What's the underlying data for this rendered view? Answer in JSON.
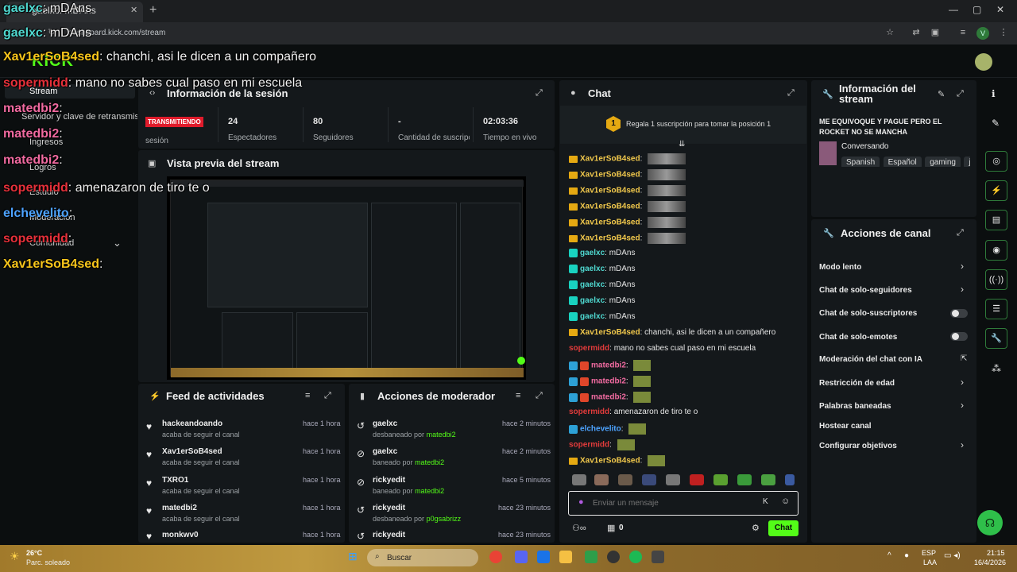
{
  "browser": {
    "tab_title": "gaelxc: mDAns",
    "url": "dashboard.kick.com/stream"
  },
  "header": {
    "logo": "KICK"
  },
  "leftnav": {
    "items": [
      {
        "label": "Stream"
      },
      {
        "label": "Servidor y clave de retransmisión"
      },
      {
        "label": "Ingresos"
      },
      {
        "label": "Logros"
      },
      {
        "label": "Estudio"
      },
      {
        "label": "Moderación"
      },
      {
        "label": "Comunidad"
      }
    ]
  },
  "session": {
    "title": "Información de la sesión",
    "badge": "TRANSMITIENDO",
    "badge_sub": "sesión",
    "stats": [
      {
        "value": "24",
        "label": "Espectadores"
      },
      {
        "value": "80",
        "label": "Seguidores"
      },
      {
        "value": "-",
        "label": "Cantidad de suscripciones"
      },
      {
        "value": "02:03:36",
        "label": "Tiempo en vivo"
      }
    ]
  },
  "preview": {
    "title": "Vista previa del stream"
  },
  "feed": {
    "title": "Feed de actividades",
    "items": [
      {
        "name": "hackeandoando",
        "sub": "acaba de seguir el canal",
        "time": "hace 1 hora"
      },
      {
        "name": "Xav1erSoB4sed",
        "sub": "acaba de seguir el canal",
        "time": "hace 1 hora"
      },
      {
        "name": "TXRO1",
        "sub": "acaba de seguir el canal",
        "time": "hace 1 hora"
      },
      {
        "name": "matedbi2",
        "sub": "acaba de seguir el canal",
        "time": "hace 1 hora"
      },
      {
        "name": "monkwv0",
        "sub": "",
        "time": "hace 1 hora"
      }
    ]
  },
  "modactions": {
    "title": "Acciones de moderador",
    "items": [
      {
        "name": "gaelxc",
        "action": "desbaneado por",
        "by": "matedbi2",
        "time": "hace 2 minutos"
      },
      {
        "name": "gaelxc",
        "action": "baneado por",
        "by": "matedbi2",
        "time": "hace 2 minutos"
      },
      {
        "name": "rickyedit",
        "action": "baneado por",
        "by": "matedbi2",
        "time": "hace 5 minutos"
      },
      {
        "name": "rickyedit",
        "action": "desbaneado por",
        "by": "p0gsabrizz",
        "time": "hace 23 minutos"
      },
      {
        "name": "rickyedit",
        "action": "",
        "by": "",
        "time": "hace 23 minutos"
      }
    ]
  },
  "chat": {
    "title": "Chat",
    "gift_text": "Regala 1 suscripción para tomar la posición 1",
    "gift_rank": "1",
    "messages": [
      {
        "user": "Xav1erSoB4sed",
        "text": "",
        "style": "gold",
        "emote": true
      },
      {
        "user": "Xav1erSoB4sed",
        "text": "",
        "style": "gold",
        "emote": true
      },
      {
        "user": "Xav1erSoB4sed",
        "text": "",
        "style": "gold",
        "emote": true
      },
      {
        "user": "Xav1erSoB4sed",
        "text": "",
        "style": "gold",
        "emote": true
      },
      {
        "user": "Xav1erSoB4sed",
        "text": "",
        "style": "gold",
        "emote": true
      },
      {
        "user": "Xav1erSoB4sed",
        "text": "",
        "style": "gold",
        "emote": true
      },
      {
        "user": "gaelxc",
        "text": "mDAns",
        "style": "teal"
      },
      {
        "user": "gaelxc",
        "text": "mDAns",
        "style": "teal"
      },
      {
        "user": "gaelxc",
        "text": "mDAns",
        "style": "teal"
      },
      {
        "user": "gaelxc",
        "text": "mDAns",
        "style": "teal"
      },
      {
        "user": "gaelxc",
        "text": "mDAns",
        "style": "teal"
      },
      {
        "user": "Xav1erSoB4sed",
        "text": "chanchi, asi le dicen a un compañero",
        "style": "gold"
      },
      {
        "user": "sopermidd",
        "text": "mano no sabes cual paso en mi escuela",
        "style": "red"
      },
      {
        "user": "matedbi2",
        "text": "",
        "style": "pink"
      },
      {
        "user": "matedbi2",
        "text": "",
        "style": "pink"
      },
      {
        "user": "matedbi2",
        "text": "",
        "style": "pink"
      },
      {
        "user": "sopermidd",
        "text": "amenazaron de tiro te o",
        "style": "red"
      },
      {
        "user": "elchevelito",
        "text": "",
        "style": "blue"
      },
      {
        "user": "sopermidd",
        "text": "",
        "style": "red"
      },
      {
        "user": "Xav1erSoB4sed",
        "text": "",
        "style": "gold"
      }
    ],
    "input_placeholder": "Enviar un mensaje",
    "points": "0",
    "send_label": "Chat"
  },
  "streaminfo": {
    "title": "Información del stream",
    "stream_title": "ME EQUIVOQUE Y PAGUE PERO EL ROCKET NO SE MANCHA",
    "category": "Conversando",
    "tags": [
      "Spanish",
      "Español",
      "gaming",
      "je"
    ]
  },
  "channel_actions": {
    "title": "Acciones de canal",
    "items": [
      {
        "label": "Modo lento",
        "control": "chevron"
      },
      {
        "label": "Chat de solo-seguidores",
        "control": "chevron"
      },
      {
        "label": "Chat de solo-suscriptores",
        "control": "toggle"
      },
      {
        "label": "Chat de solo-emotes",
        "control": "toggle"
      },
      {
        "label": "Moderación del chat con IA",
        "control": "external"
      },
      {
        "label": "Restricción de edad",
        "control": "chevron"
      },
      {
        "label": "Palabras baneadas",
        "control": "chevron"
      },
      {
        "label": "Hostear canal",
        "control": "none"
      },
      {
        "label": "Configurar objetivos",
        "control": "chevron"
      }
    ]
  },
  "overlay": {
    "lines": [
      {
        "user": "gaelxc",
        "text": "mDAns",
        "style": "teal"
      },
      {
        "user": "gaelxc",
        "text": "mDAns",
        "style": "teal"
      },
      {
        "user": "Xav1erSoB4sed",
        "text": "chanchi, asi le dicen a un compañero",
        "style": "gold"
      },
      {
        "user": "sopermidd",
        "text": "mano no sabes cual paso en mi escuela",
        "style": "red"
      },
      {
        "user": "matedbi2",
        "text": "",
        "style": "pink"
      },
      {
        "user": "matedbi2",
        "text": "",
        "style": "pink"
      },
      {
        "user": "matedbi2",
        "text": "",
        "style": "pink"
      },
      {
        "user": "sopermidd",
        "text": "amenazaron de tiro te o",
        "style": "red"
      },
      {
        "user": "elchevelito",
        "text": "",
        "style": "blue"
      },
      {
        "user": "sopermidd",
        "text": "",
        "style": "red"
      },
      {
        "user": "Xav1erSoB4sed",
        "text": "",
        "style": "gold"
      }
    ]
  },
  "taskbar": {
    "weather_temp": "26°C",
    "weather_desc": "Parc. soleado",
    "search": "Buscar",
    "lang": "ESP",
    "lang_sub": "LAA",
    "time": "21:15",
    "date": "16/4/2026"
  },
  "colors": {
    "accent": "#53fc18",
    "panel": "#14181b",
    "bg": "#0b0e0f"
  }
}
